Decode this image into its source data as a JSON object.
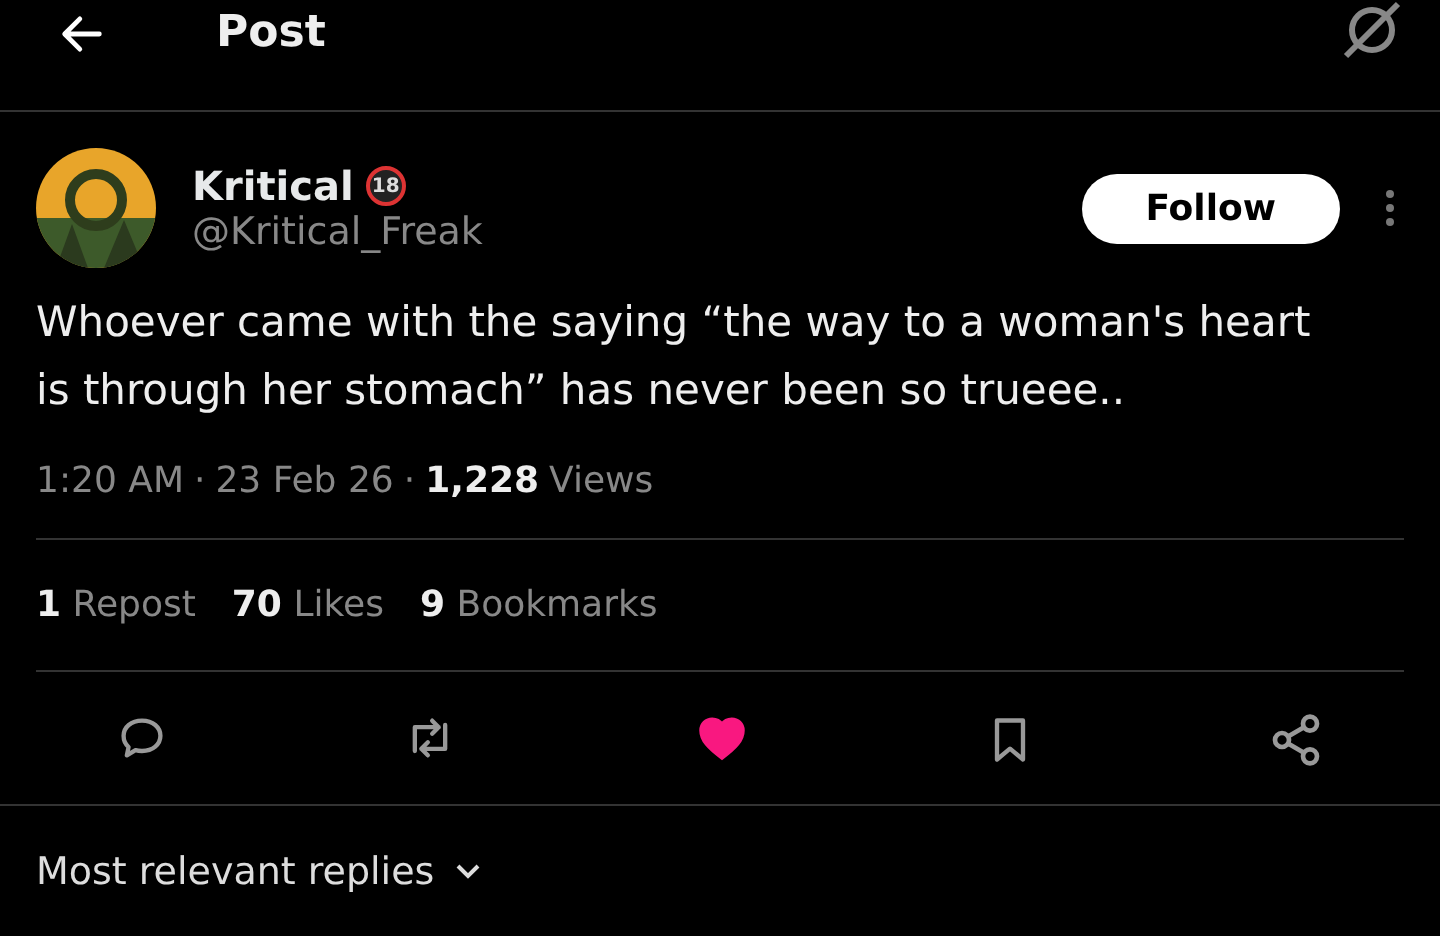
{
  "header": {
    "title": "Post"
  },
  "author": {
    "name": "Kritical",
    "badge": "18",
    "handle": "@Kritical_Freak",
    "follow_label": "Follow"
  },
  "post": {
    "text": "Whoever came with the saying “the way to a woman's heart is through her stomach” has never been so trueee..",
    "time": "1:20 AM",
    "date": "23 Feb 26",
    "views_count": "1,228",
    "views_label": "Views",
    "separator": "·"
  },
  "stats": [
    {
      "count": "1",
      "label": "Repost"
    },
    {
      "count": "70",
      "label": "Likes"
    },
    {
      "count": "9",
      "label": "Bookmarks"
    }
  ],
  "actions": {
    "liked": true
  },
  "replies_sort": {
    "label": "Most relevant replies"
  }
}
